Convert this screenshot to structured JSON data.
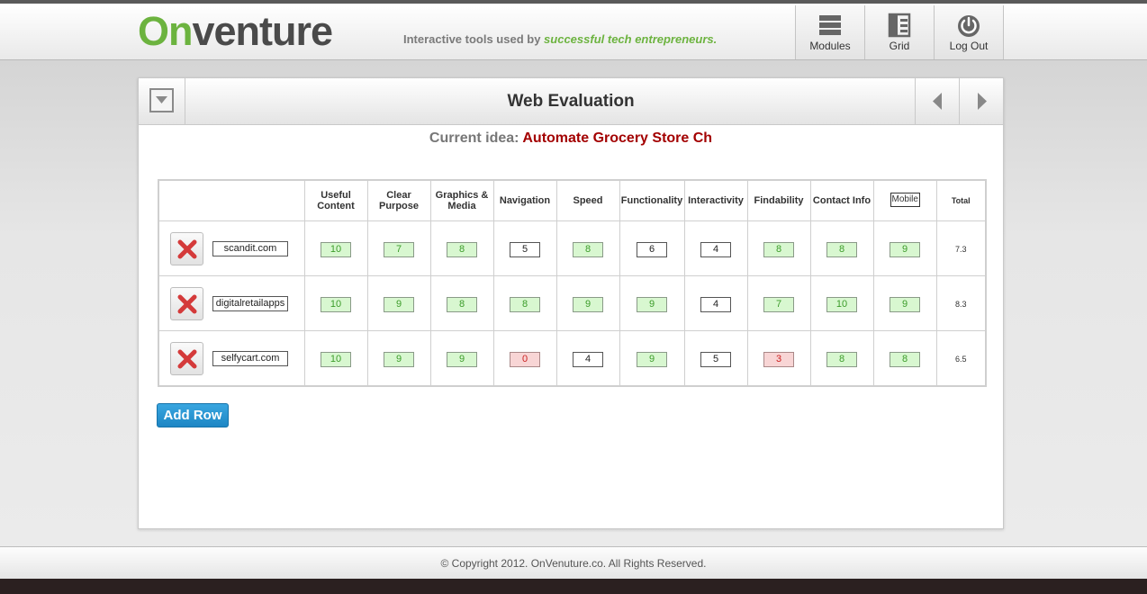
{
  "brand": {
    "logo_prefix": "On",
    "logo_rest": "venture",
    "tagline_start": "Interactive tools used by ",
    "tagline_highlight": "successful tech entrepreneurs."
  },
  "nav": [
    {
      "label": "Modules",
      "icon": "modules-icon"
    },
    {
      "label": "Grid",
      "icon": "grid-icon"
    },
    {
      "label": "Log Out",
      "icon": "power-icon"
    }
  ],
  "panel": {
    "title": "Web Evaluation",
    "current_idea_label": "Current idea:",
    "current_idea_value": "Automate Grocery Store Ch"
  },
  "table": {
    "columns": [
      "Useful Content",
      "Clear Purpose",
      "Graphics & Media",
      "Navigation",
      "Speed",
      "Functionality",
      "Interactivity",
      "Findability",
      "Contact Info",
      "Mobile",
      "Total"
    ],
    "rows": [
      {
        "site": "scandit.com",
        "scores": [
          "10",
          "7",
          "8",
          "5",
          "8",
          "6",
          "4",
          "8",
          "8",
          "9"
        ],
        "states": [
          "green",
          "green",
          "green",
          "plain",
          "green",
          "plain",
          "plain",
          "green",
          "green",
          "green"
        ],
        "total": "7.3"
      },
      {
        "site": "digitalretailapps",
        "scores": [
          "10",
          "9",
          "8",
          "8",
          "9",
          "9",
          "4",
          "7",
          "10",
          "9"
        ],
        "states": [
          "green",
          "green",
          "green",
          "green",
          "green",
          "green",
          "plain",
          "green",
          "green",
          "green"
        ],
        "total": "8.3"
      },
      {
        "site": "selfycart.com",
        "scores": [
          "10",
          "9",
          "9",
          "0",
          "4",
          "9",
          "5",
          "3",
          "8",
          "8"
        ],
        "states": [
          "green",
          "green",
          "green",
          "red",
          "plain",
          "green",
          "plain",
          "red",
          "green",
          "green"
        ],
        "total": "6.5"
      }
    ]
  },
  "add_row_label": "Add Row",
  "footer": "© Copyright 2012. OnVenuture.co. All Rights Reserved.",
  "colors": {
    "brand_green": "#6cb33f",
    "idea_red": "#a30000",
    "button_blue": "#1d86c4"
  }
}
